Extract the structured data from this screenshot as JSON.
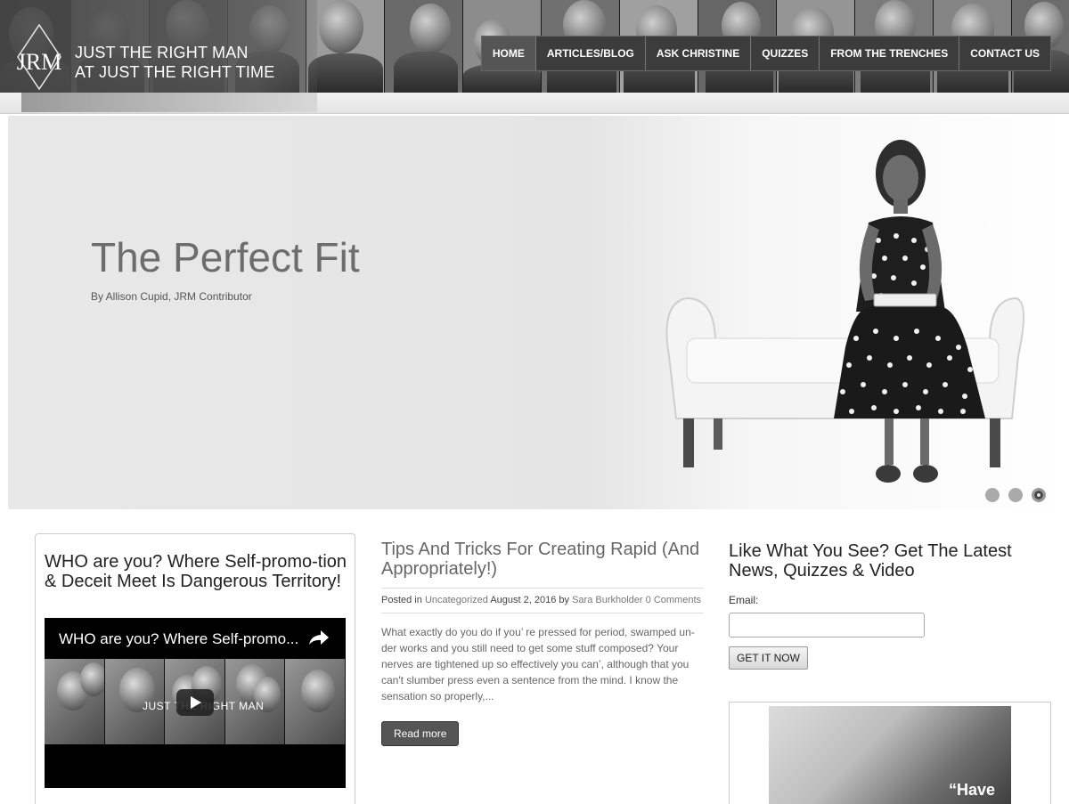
{
  "brand": {
    "logo_text": "JRM",
    "line1": "JUST THE RIGHT MAN",
    "line2": "AT JUST THE RIGHT TIME"
  },
  "nav": {
    "items": [
      {
        "label": "HOME",
        "active": true
      },
      {
        "label": "ARTICLES/BLOG",
        "active": false
      },
      {
        "label": "ASK CHRISTINE",
        "active": false
      },
      {
        "label": "QUIZZES",
        "active": false
      },
      {
        "label": "FROM THE TRENCHES",
        "active": false
      },
      {
        "label": "CONTACT US",
        "active": false
      }
    ]
  },
  "slider": {
    "title": "The Perfect Fit",
    "byline": "By Allison Cupid, JRM Contributor",
    "dots": 3,
    "active_dot": 3
  },
  "left_column": {
    "title": "WHO are you? Where Self-promo-tion & Deceit Meet Is Dangerous Territory!",
    "video": {
      "title": "WHO are you? Where Self-promo...",
      "brand_overlay": "JUST THE RIGHT MAN",
      "icon": "share-icon"
    }
  },
  "post": {
    "title": "Tips And Tricks For Creating Rapid (And Appropriately!)",
    "meta": {
      "posted_in_label": "Posted in",
      "category": "Uncategorized",
      "date": "August 2, 2016",
      "by_label": "by",
      "author": "Sara Burkholder",
      "comments": "0 Comments"
    },
    "excerpt": "What exactly do you do if you’ re pressed for period, swamped un-der works and you still need to get some stuff composed? Your nerves are tightened up so effectively you can’, although that you can't slumber press even a sentence from the mind. I know the sensation so properly,...",
    "read_more_label": "Read more"
  },
  "signup": {
    "title": "Like What You See? Get The Latest News, Quizzes & Video",
    "email_label": "Email:",
    "email_value": "",
    "submit_label": "GET IT NOW",
    "promo_text": "“Have"
  },
  "colors": {
    "nav_bg": "#3c3c3c",
    "button_dark": "#555555",
    "link_gray": "#777777"
  }
}
